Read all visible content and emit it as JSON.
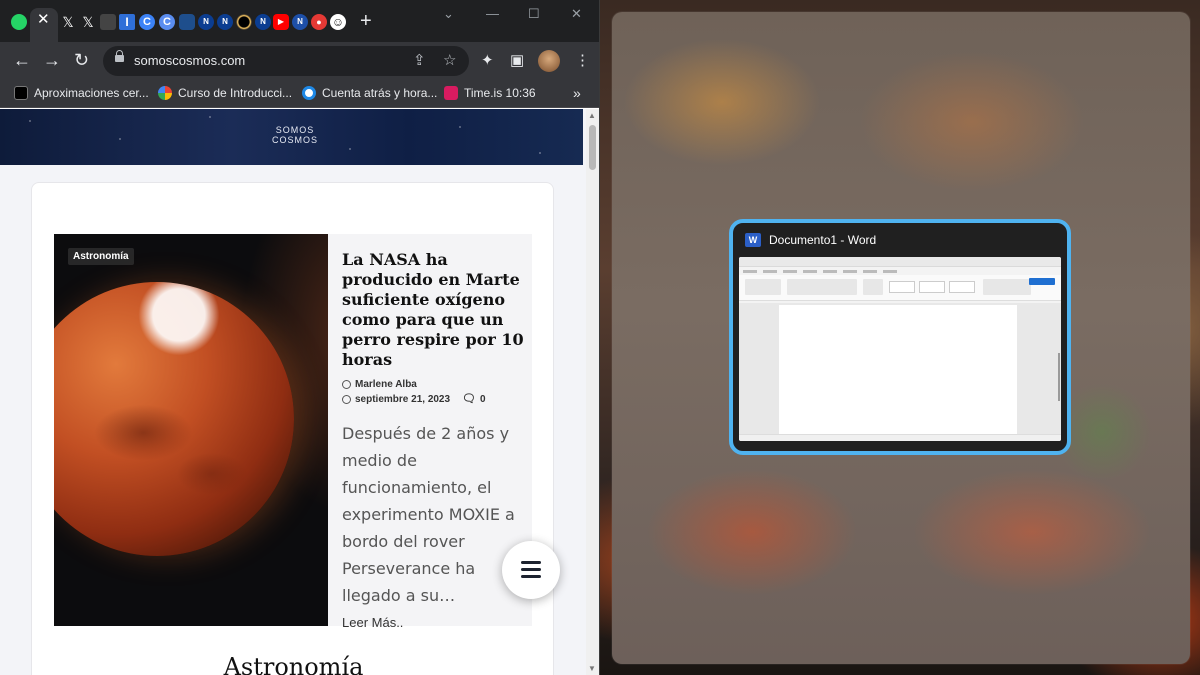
{
  "browser": {
    "tabs": [
      {
        "icon": "whatsapp-icon",
        "color": "#25d366"
      },
      {
        "icon": "close-icon",
        "label": "✕",
        "active": true
      },
      {
        "icon": "x-icon",
        "label": "𝕏"
      },
      {
        "icon": "x-icon",
        "label": "𝕏"
      },
      {
        "icon": "dots-icon",
        "color": "#555555"
      },
      {
        "icon": "instapaper-icon",
        "label": "I",
        "color": "#2f6fd8"
      },
      {
        "icon": "copilot-icon",
        "label": "C",
        "color": "#3b82f6"
      },
      {
        "icon": "copilot-icon",
        "label": "C",
        "color": "#5a8df0"
      },
      {
        "icon": "hex-icon",
        "color": "#1e4e8c"
      },
      {
        "icon": "nasa-icon",
        "label": "N",
        "color": "#0b3d91"
      },
      {
        "icon": "nasa-icon",
        "label": "N",
        "color": "#0b3d91"
      },
      {
        "icon": "eclipse-icon",
        "color": "#222222"
      },
      {
        "icon": "nasa-icon",
        "label": "N",
        "color": "#0b3d91"
      },
      {
        "icon": "youtube-icon",
        "label": "▶",
        "color": "#ff0000"
      },
      {
        "icon": "nasa-icon",
        "label": "N",
        "color": "#1d4fa8"
      },
      {
        "icon": "record-icon",
        "label": "●",
        "color": "#e53935"
      },
      {
        "icon": "face-icon",
        "label": "☺",
        "color": "#ffffff"
      }
    ],
    "new_tab_label": "+",
    "window_controls": {
      "tab_search": "⌄",
      "minimize": "—",
      "maximize": "☐",
      "close": "✕"
    },
    "nav": {
      "back": "←",
      "forward": "→",
      "reload": "↻"
    },
    "url": "somoscosmos.com",
    "omnibox_icons": {
      "share": "⇪",
      "bookmark": "☆"
    },
    "toolbar_icons": {
      "extensions": "✦",
      "side_panel": "▣",
      "menu": "⋮"
    },
    "bookmarks": [
      {
        "label": "Aproximaciones cer...",
        "color": "#000000",
        "icon": "cnbo-icon"
      },
      {
        "label": "Curso de Introducci...",
        "color": "#4285f4",
        "icon": "google-icon"
      },
      {
        "label": "Cuenta atrás y hora...",
        "color": "#1e88e5",
        "icon": "clock-icon"
      },
      {
        "label": "Time.is 10:36",
        "color": "#d81b60",
        "icon": "timeis-icon"
      }
    ],
    "bookmarks_more": "»"
  },
  "site": {
    "logo_line1": "SOMOS",
    "logo_line2": "COSMOS",
    "article": {
      "category": "Astronomía",
      "title": "La NASA ha producido en Marte suficiente oxígeno como para que un perro respire por 10 horas",
      "author": "Marlene Alba",
      "date": "septiembre 21, 2023",
      "comments": "0",
      "excerpt": "Después de 2 años y medio de funcionamiento, el experimento MOXIE a bordo del rover Perseverance ha llegado a su…",
      "read_more": "Leer Más.."
    },
    "section_heading": "Astronomía"
  },
  "snap": {
    "window_title": "Documento1 - Word",
    "app_letter": "W",
    "accent": "#4fb3f0"
  }
}
